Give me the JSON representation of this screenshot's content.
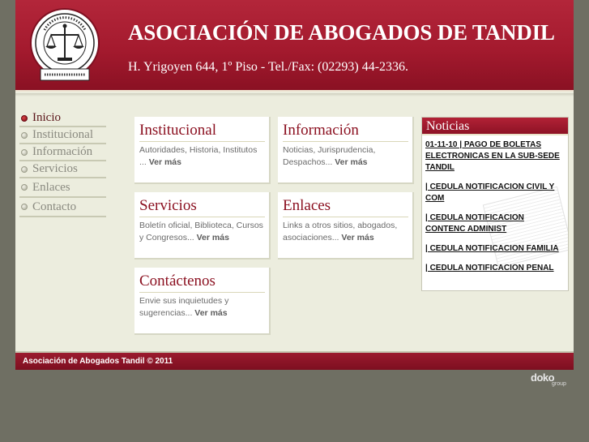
{
  "header": {
    "logo_text": "Asociación de Abogados de Tandil · Justicia es Libertad",
    "title": "ASOCIACIÓN DE ABOGADOS DE TANDIL",
    "address": "H. Yrigoyen 644, 1º Piso - Tel./Fax: (02293) 44-2336."
  },
  "nav": {
    "items": [
      {
        "label": "Inicio",
        "active": true
      },
      {
        "label": "Institucional",
        "active": false
      },
      {
        "label": "Información",
        "active": false
      },
      {
        "label": "Servicios",
        "active": false
      },
      {
        "label": "Enlaces",
        "active": false
      },
      {
        "label": "Contacto",
        "active": false
      }
    ]
  },
  "cards": [
    {
      "title": "Institucional",
      "text": "Autoridades, Historia, Institutos ...",
      "more": "Ver más"
    },
    {
      "title": "Información",
      "text": "Noticias, Jurisprudencia, Despachos...",
      "more": "Ver más"
    },
    {
      "title": "Servicios",
      "text": "Boletín oficial, Biblioteca, Cursos y Congresos...",
      "more": "Ver más"
    },
    {
      "title": "Enlaces",
      "text": "Links a otros sitios, abogados, asociaciones...",
      "more": "Ver más"
    },
    {
      "title": "Contáctenos",
      "text": "Envie sus inquietudes y sugerencias...",
      "more": "Ver más"
    }
  ],
  "news": {
    "title": "Noticias",
    "items": [
      "01-11-10 | PAGO DE BOLETAS ELECTRONICAS EN LA SUB-SEDE TANDIL",
      " | CEDULA NOTIFICACION CIVIL Y COM",
      " | CEDULA NOTIFICACION CONTENC ADMINIST",
      " | CEDULA NOTIFICACION FAMILIA",
      " | CEDULA NOTIFICACION PENAL"
    ]
  },
  "footer": {
    "text": "Asociación de Abogados Tandil © 2011"
  },
  "brand": {
    "name": "doko",
    "sub": "group"
  },
  "colors": {
    "accent": "#a41a2e",
    "background": "#ecedde",
    "outer": "#6f6f63"
  }
}
